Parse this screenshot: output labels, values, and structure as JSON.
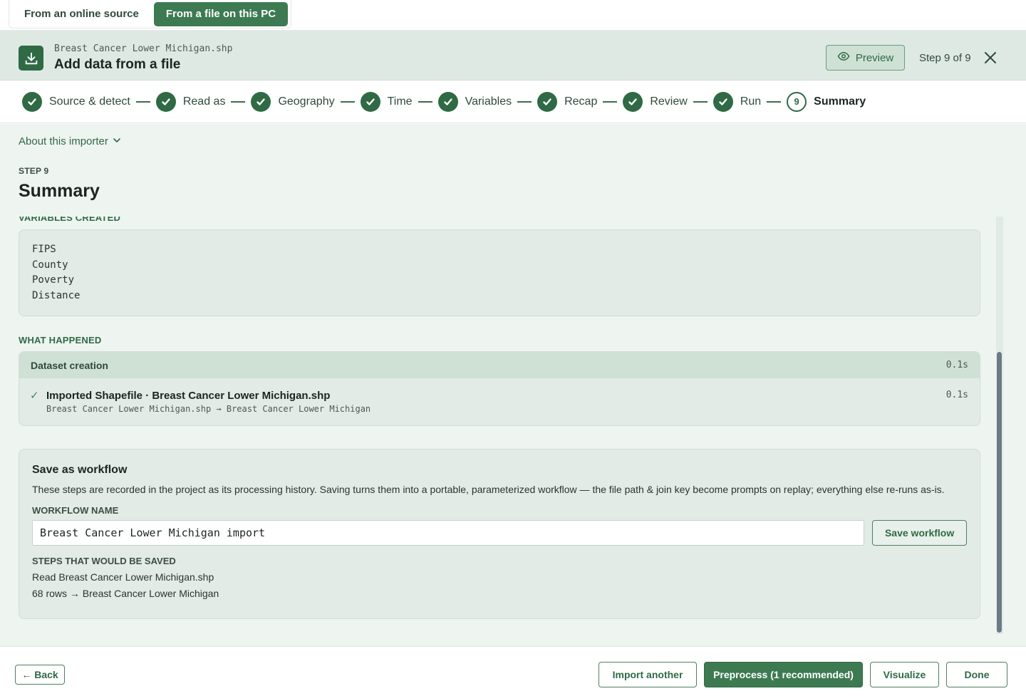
{
  "source_tabs": {
    "online": "From an online source",
    "file": "From a file on this PC"
  },
  "header": {
    "file_name": "Breast Cancer Lower Michigan.shp",
    "title": "Add data from a file",
    "preview_label": "Preview",
    "step_count": "Step 9 of 9"
  },
  "stepper": {
    "steps": [
      {
        "label": "Source & detect",
        "state": "done"
      },
      {
        "label": "Read as",
        "state": "done"
      },
      {
        "label": "Geography",
        "state": "done"
      },
      {
        "label": "Time",
        "state": "done"
      },
      {
        "label": "Variables",
        "state": "done"
      },
      {
        "label": "Recap",
        "state": "done"
      },
      {
        "label": "Review",
        "state": "done"
      },
      {
        "label": "Run",
        "state": "done"
      },
      {
        "label": "Summary",
        "state": "current",
        "number": "9"
      }
    ]
  },
  "main": {
    "about_label": "About this importer",
    "step_kicker": "STEP 9",
    "step_heading": "Summary",
    "variables_label": "VARIABLES CREATED",
    "variables": [
      "FIPS",
      "County",
      "Poverty",
      "Distance"
    ],
    "happened_label": "WHAT HAPPENED",
    "happened": {
      "group_title": "Dataset creation",
      "group_time": "0.1s",
      "row_title": "Imported Shapefile · Breast Cancer Lower Michigan.shp",
      "row_sub": "Breast Cancer Lower Michigan.shp → Breast Cancer Lower Michigan",
      "row_time": "0.1s"
    },
    "workflow": {
      "title": "Save as workflow",
      "description": "These steps are recorded in the project as its processing history. Saving turns them into a portable, parameterized workflow — the file path & join key become prompts on replay; everything else re-runs as-is.",
      "name_label": "WORKFLOW NAME",
      "name_value": "Breast Cancer Lower Michigan import",
      "save_label": "Save workflow",
      "steps_label": "STEPS THAT WOULD BE SAVED",
      "steps": [
        "Read Breast Cancer Lower Michigan.shp",
        "68 rows → Breast Cancer Lower Michigan"
      ]
    }
  },
  "footer": {
    "back_label": "← Back",
    "import_another_label": "Import another",
    "preprocess_label": "Preprocess (1 recommended)",
    "visualize_label": "Visualize",
    "done_label": "Done"
  },
  "colors": {
    "accent": "#2f6a44",
    "primary_button": "#3d7a52",
    "header_bg": "#dfe9e3",
    "main_bg": "#eef4f0"
  }
}
